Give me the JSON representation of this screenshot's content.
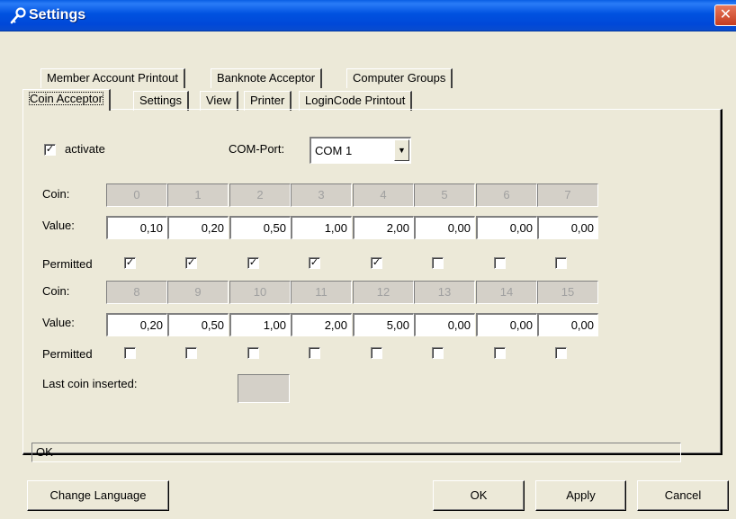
{
  "window": {
    "title": "Settings",
    "close_glyph": "✕"
  },
  "tabs_back": [
    "Member Account Printout",
    "Banknote Acceptor",
    "Computer Groups"
  ],
  "tabs_front": [
    "Coin Acceptor",
    "Settings",
    "View",
    "Printer",
    "LoginCode Printout"
  ],
  "active_tab": "Coin Acceptor",
  "activate": {
    "label": "activate",
    "checked": true
  },
  "com_port": {
    "label": "COM-Port:",
    "value": "COM 1"
  },
  "row_labels": {
    "coin": "Coin:",
    "value": "Value:",
    "permitted": "Permitted"
  },
  "groups": [
    {
      "coins": [
        "0",
        "1",
        "2",
        "3",
        "4",
        "5",
        "6",
        "7"
      ],
      "values": [
        "0,10",
        "0,20",
        "0,50",
        "1,00",
        "2,00",
        "0,00",
        "0,00",
        "0,00"
      ],
      "permitted": [
        true,
        true,
        true,
        true,
        true,
        false,
        false,
        false
      ]
    },
    {
      "coins": [
        "8",
        "9",
        "10",
        "11",
        "12",
        "13",
        "14",
        "15"
      ],
      "values": [
        "0,20",
        "0,50",
        "1,00",
        "2,00",
        "5,00",
        "0,00",
        "0,00",
        "0,00"
      ],
      "permitted": [
        false,
        false,
        false,
        false,
        false,
        false,
        false,
        false
      ]
    }
  ],
  "last_coin": {
    "label": "Last coin inserted:",
    "value": ""
  },
  "status": "OK",
  "buttons": {
    "change_language": "Change Language",
    "ok": "OK",
    "apply": "Apply",
    "cancel": "Cancel"
  },
  "icons": {
    "title": "wrench-key-icon",
    "combo": "dropdown-arrow-icon"
  },
  "colors": {
    "titlebar": "#0054e3",
    "close": "#d9502f",
    "face": "#ece9d8"
  }
}
